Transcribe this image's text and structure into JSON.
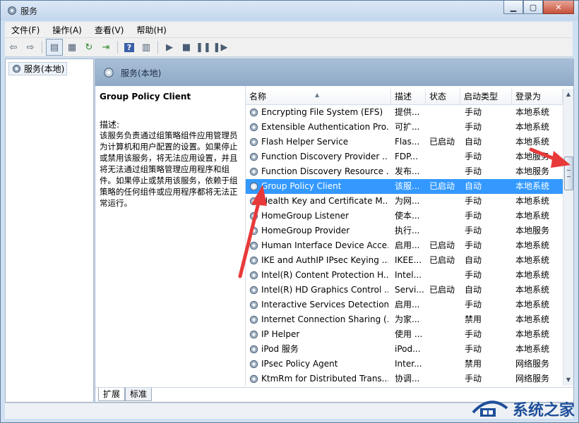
{
  "window": {
    "title": "服务"
  },
  "menu": [
    "文件(F)",
    "操作(A)",
    "查看(V)",
    "帮助(H)"
  ],
  "tree": {
    "root_label": "服务(本地)"
  },
  "pane": {
    "header_title": "服务(本地)"
  },
  "description": {
    "service_title": "Group Policy Client",
    "label": "描述:",
    "text": "该服务负责通过组策略组件应用管理员为计算机和用户配置的设置。如果停止或禁用该服务，将无法应用设置，并且将无法通过组策略管理应用程序和组件。如果停止或禁用该服务，依赖于组策略的任何组件或应用程序都将无法正常运行。"
  },
  "columns": {
    "name": "名称",
    "desc": "描述",
    "status": "状态",
    "startup": "启动类型",
    "logon": "登录为"
  },
  "services": [
    {
      "name": "Encrypting File System (EFS)",
      "desc": "提供...",
      "status": "",
      "startup": "手动",
      "logon": "本地系统"
    },
    {
      "name": "Extensible Authentication Pro...",
      "desc": "可扩...",
      "status": "",
      "startup": "手动",
      "logon": "本地系统"
    },
    {
      "name": "Flash Helper Service",
      "desc": "Flas...",
      "status": "已启动",
      "startup": "自动",
      "logon": "本地系统"
    },
    {
      "name": "Function Discovery Provider ...",
      "desc": "FDP...",
      "status": "",
      "startup": "手动",
      "logon": "本地服务"
    },
    {
      "name": "Function Discovery Resource ...",
      "desc": "发布...",
      "status": "",
      "startup": "手动",
      "logon": "本地服务"
    },
    {
      "name": "Group Policy Client",
      "desc": "该服...",
      "status": "已启动",
      "startup": "自动",
      "logon": "本地系统",
      "selected": true
    },
    {
      "name": "Health Key and Certificate M...",
      "desc": "为网...",
      "status": "",
      "startup": "手动",
      "logon": "本地系统"
    },
    {
      "name": "HomeGroup Listener",
      "desc": "使本...",
      "status": "",
      "startup": "手动",
      "logon": "本地系统"
    },
    {
      "name": "HomeGroup Provider",
      "desc": "执行...",
      "status": "",
      "startup": "手动",
      "logon": "本地服务"
    },
    {
      "name": "Human Interface Device Acce...",
      "desc": "启用...",
      "status": "已启动",
      "startup": "手动",
      "logon": "本地系统"
    },
    {
      "name": "IKE and AuthIP IPsec Keying ...",
      "desc": "IKEE...",
      "status": "已启动",
      "startup": "自动",
      "logon": "本地系统"
    },
    {
      "name": "Intel(R) Content Protection H...",
      "desc": "Intel...",
      "status": "",
      "startup": "手动",
      "logon": "本地系统"
    },
    {
      "name": "Intel(R) HD Graphics Control ...",
      "desc": "Servi...",
      "status": "已启动",
      "startup": "自动",
      "logon": "本地系统"
    },
    {
      "name": "Interactive Services Detection",
      "desc": "启用...",
      "status": "",
      "startup": "手动",
      "logon": "本地系统"
    },
    {
      "name": "Internet Connection Sharing (...",
      "desc": "为家...",
      "status": "",
      "startup": "禁用",
      "logon": "本地系统"
    },
    {
      "name": "IP Helper",
      "desc": "使用 ...",
      "status": "",
      "startup": "手动",
      "logon": "本地系统"
    },
    {
      "name": "iPod 服务",
      "desc": "iPod...",
      "status": "",
      "startup": "手动",
      "logon": "本地系统"
    },
    {
      "name": "IPsec Policy Agent",
      "desc": "Inter...",
      "status": "",
      "startup": "禁用",
      "logon": "网络服务"
    },
    {
      "name": "KtmRm for Distributed Trans...",
      "desc": "协调...",
      "status": "",
      "startup": "手动",
      "logon": "网络服务"
    }
  ],
  "tabs": [
    "扩展",
    "标准"
  ],
  "watermark": {
    "text": "系统之家"
  },
  "colors": {
    "selection": "#3399ff",
    "annotation_arrow": "#e8393a"
  }
}
